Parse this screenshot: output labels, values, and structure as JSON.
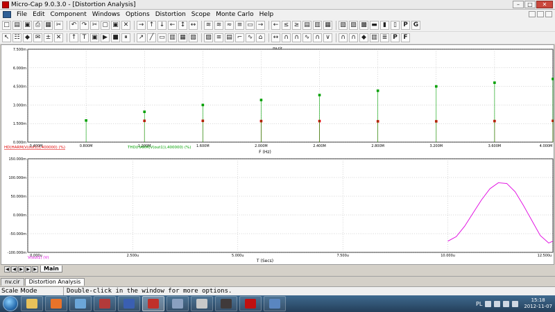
{
  "window": {
    "title": "Micro-Cap 9.0.3.0 - [Distortion Analysis]",
    "controls": [
      "–",
      "□",
      "✕"
    ]
  },
  "menu": [
    "File",
    "Edit",
    "Component",
    "Windows",
    "Options",
    "Distortion",
    "Scope",
    "Monte Carlo",
    "Help"
  ],
  "toolbar1": {
    "glyphs": [
      "□",
      "▤",
      "▣",
      "⎙",
      "▦",
      "✂",
      "↶",
      "↷",
      "✂",
      "▢",
      "▣",
      "✕",
      "→",
      "↑",
      "↓",
      "←",
      "↕",
      "↔",
      "≋",
      "≋",
      "≈",
      "≡",
      "▭",
      "→",
      "←",
      "≤",
      "≥",
      "▤",
      "▥",
      "▦",
      "▧",
      "▨",
      "▩",
      "▬",
      "▮",
      "▯"
    ],
    "letters": [
      "P",
      "G"
    ]
  },
  "toolbar2": {
    "glyphs": [
      "↖",
      "☷",
      "◆",
      "✉",
      "±",
      "✕",
      "↑",
      "T",
      "▣",
      "▶",
      "■",
      "⏸",
      "↗",
      "╱",
      "▭",
      "▥",
      "▦",
      "▧",
      "▨",
      "≡",
      "▤",
      "⌐",
      "∿",
      "⌂",
      "↔",
      "∩",
      "∩",
      "∿",
      "∩",
      "∨",
      "∩",
      "∩",
      "◆",
      "▥",
      "≣"
    ],
    "letters": [
      "P",
      "F"
    ]
  },
  "plot": {
    "file_label": "nv.cir",
    "top": {
      "xlabel": "F (Hz)",
      "y_ticks": [
        "7.500m",
        "6.000m",
        "4.500m",
        "3.000m",
        "1.500m",
        "0.000m"
      ],
      "x_ticks": [
        "0.400M",
        "0.800M",
        "1.200M",
        "1.600M",
        "2.000M",
        "2.400M",
        "2.800M",
        "3.200M",
        "3.600M",
        "4.000M"
      ],
      "legend": [
        {
          "text": "HD(HARM(V(out1)),400000) (%)",
          "color": "#e00000"
        },
        {
          "text": "THD(HARM(V(out1)),400000) (%)",
          "color": "#00a000"
        }
      ]
    },
    "bottom": {
      "xlabel": "T (Secs)",
      "y_ticks": [
        "150.000m",
        "100.000m",
        "50.000m",
        "0.000m",
        "-50.000m",
        "-100.000m"
      ],
      "x_ticks": [
        "0.000u",
        "2.500u",
        "5.000u",
        "7.500u",
        "10.000u",
        "12.500u"
      ],
      "legend": [
        {
          "text": "V(out1) (V)",
          "color": "#e000e0"
        }
      ]
    }
  },
  "chart_data": [
    {
      "type": "scatter",
      "xlabel": "F (Hz)",
      "xlim": [
        400000,
        4000000
      ],
      "ylim": [
        0,
        0.0075
      ],
      "grid": true,
      "legend_placement": "bottom-left",
      "series": [
        {
          "name": "HD(HARM(V(out1)),400000) (%)",
          "color": "#e00000",
          "x": [
            1200000,
            1600000,
            2000000,
            2400000,
            2800000,
            3200000,
            3600000,
            4000000
          ],
          "y": [
            0.00172,
            0.00172,
            0.0017,
            0.0017,
            0.00168,
            0.00168,
            0.0017,
            0.00172
          ]
        },
        {
          "name": "THD(HARM(V(out1)),400000) (%)",
          "color": "#00a000",
          "x": [
            800000,
            1200000,
            1600000,
            2000000,
            2400000,
            2800000,
            3200000,
            3600000,
            4000000
          ],
          "y": [
            0.00175,
            0.00245,
            0.003,
            0.0034,
            0.0038,
            0.00415,
            0.0045,
            0.0048,
            0.0051
          ]
        }
      ]
    },
    {
      "type": "line",
      "xlabel": "T (Secs)",
      "xlim": [
        0,
        1.25e-05
      ],
      "ylim": [
        -0.1,
        0.15
      ],
      "grid": true,
      "legend_placement": "bottom-left",
      "series": [
        {
          "name": "V(out1) (V)",
          "color": "#e000e0",
          "x": [
            1e-05,
            1.02e-05,
            1.04e-05,
            1.06e-05,
            1.08e-05,
            1.1e-05,
            1.12e-05,
            1.14e-05,
            1.16e-05,
            1.18e-05,
            1.2e-05,
            1.22e-05,
            1.24e-05,
            1.25e-05
          ],
          "y": [
            -0.07,
            -0.058,
            -0.03,
            0.005,
            0.04,
            0.07,
            0.086,
            0.084,
            0.062,
            0.025,
            -0.015,
            -0.055,
            -0.075,
            -0.07
          ]
        }
      ]
    }
  ],
  "page_tabs": {
    "nav": [
      "◀",
      "◀",
      "▶",
      "▶",
      "▶"
    ],
    "items": [
      "Main"
    ]
  },
  "doc_tabs": [
    "nv.cir",
    "Distortion Analysis"
  ],
  "status": {
    "mode": "Scale Mode",
    "message": "Double-click in the window for more options."
  },
  "taskbar": {
    "apps": [
      {
        "icon": "folder-icon",
        "color": "#e8c15a"
      },
      {
        "icon": "firefox-icon",
        "color": "#e8732a"
      },
      {
        "icon": "network-icon",
        "color": "#6ba6d9"
      },
      {
        "icon": "archive-icon",
        "color": "#b23a3a"
      },
      {
        "icon": "floppy-icon",
        "color": "#3a5fb2"
      },
      {
        "icon": "microcap-icon",
        "color": "#c0302a"
      },
      {
        "icon": "m-app-icon",
        "color": "#8aa0c0"
      },
      {
        "icon": "disc-icon",
        "color": "#c8c8c8"
      },
      {
        "icon": "book-icon",
        "color": "#403a3a"
      },
      {
        "icon": "pdf-icon",
        "color": "#c01010"
      },
      {
        "icon": "window-icon",
        "color": "#5a86c0"
      }
    ],
    "language": "PL",
    "time": "15:18",
    "date": "2012-11-07"
  }
}
